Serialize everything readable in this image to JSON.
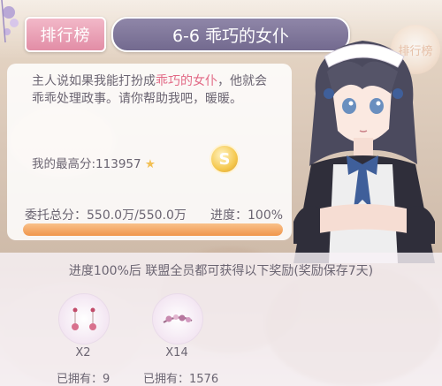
{
  "header": {
    "rank_tab_label": "排行榜",
    "stage_title": "6-6 乖巧的女仆",
    "side_badge_label": "排行榜"
  },
  "mission": {
    "desc_part1": "主人说如果我能打扮成",
    "desc_highlight": "乖巧的女仆",
    "desc_part2": "，他就会乖乖处理政事。请你帮助我吧，暖暖。",
    "best_score_label": "我的最高分:113957",
    "coin_letter": "S"
  },
  "progress": {
    "total_label": "委托总分：550.0万/550.0万",
    "progress_label": "进度：100%",
    "value": 1.0
  },
  "rewards": {
    "header": "进度100%后 联盟全员都可获得以下奖励(奖励保存7天)",
    "items": [
      {
        "icon": "earring-icon",
        "qty": "X2",
        "owned": "已拥有：9"
      },
      {
        "icon": "hairpin-icon",
        "qty": "X14",
        "owned": "已拥有：1576"
      }
    ]
  },
  "colors": {
    "accent_pink": "#e28da6",
    "title_purple": "#736a8f",
    "progress_orange": "#f0964c",
    "highlight_text": "#e26a86"
  }
}
